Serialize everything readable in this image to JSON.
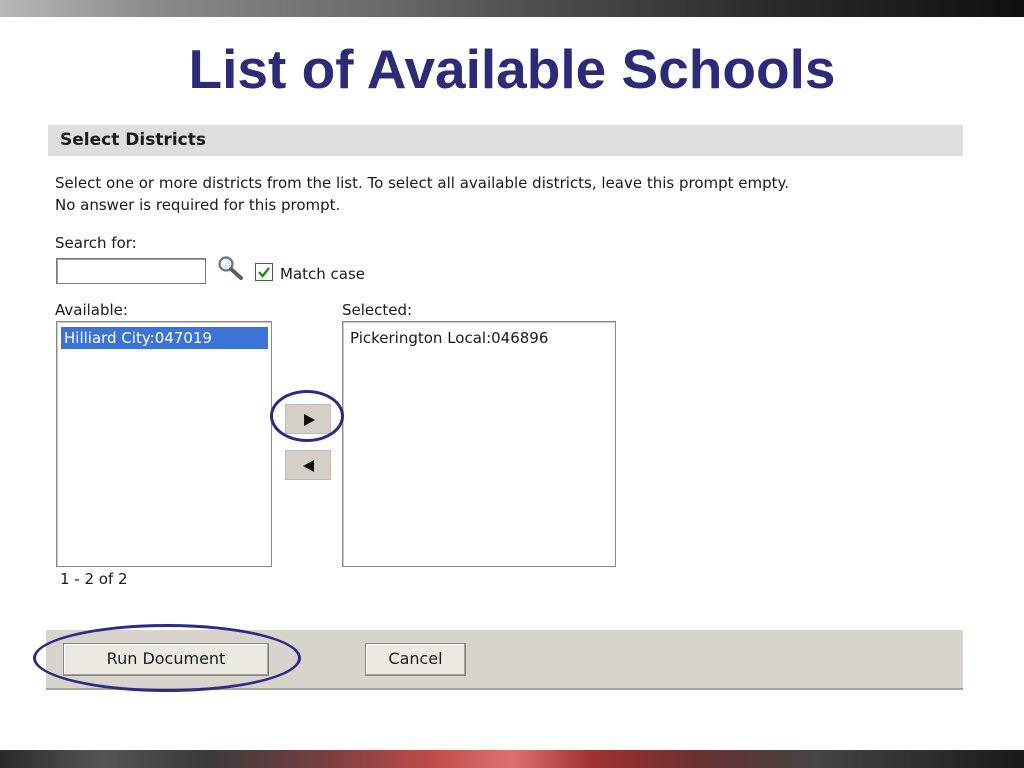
{
  "title": "List of Available Schools",
  "section": {
    "header": "Select Districts",
    "desc_line1": "Select one or more districts from the list.  To select all available districts, leave this prompt empty.",
    "desc_line2": "No answer is required for this prompt."
  },
  "search": {
    "label": "Search for:",
    "value": "",
    "placeholder": "",
    "match_case_label": "Match case",
    "match_case_checked": true
  },
  "available": {
    "label": "Available:",
    "items": [
      "Hilliard City:047019"
    ],
    "pager": "1 - 2 of 2"
  },
  "selected": {
    "label": "Selected:",
    "items": [
      "Pickerington Local:046896"
    ]
  },
  "icons": {
    "search": "magnifier-icon",
    "add": "right-arrow-icon",
    "remove": "left-arrow-icon",
    "check": "checkmark-icon"
  },
  "buttons": {
    "run": "Run Document",
    "cancel": "Cancel"
  },
  "colors": {
    "title": "#2b2b7a",
    "highlight_circle": "#2b2b8a",
    "selection": "#3b73d6"
  }
}
